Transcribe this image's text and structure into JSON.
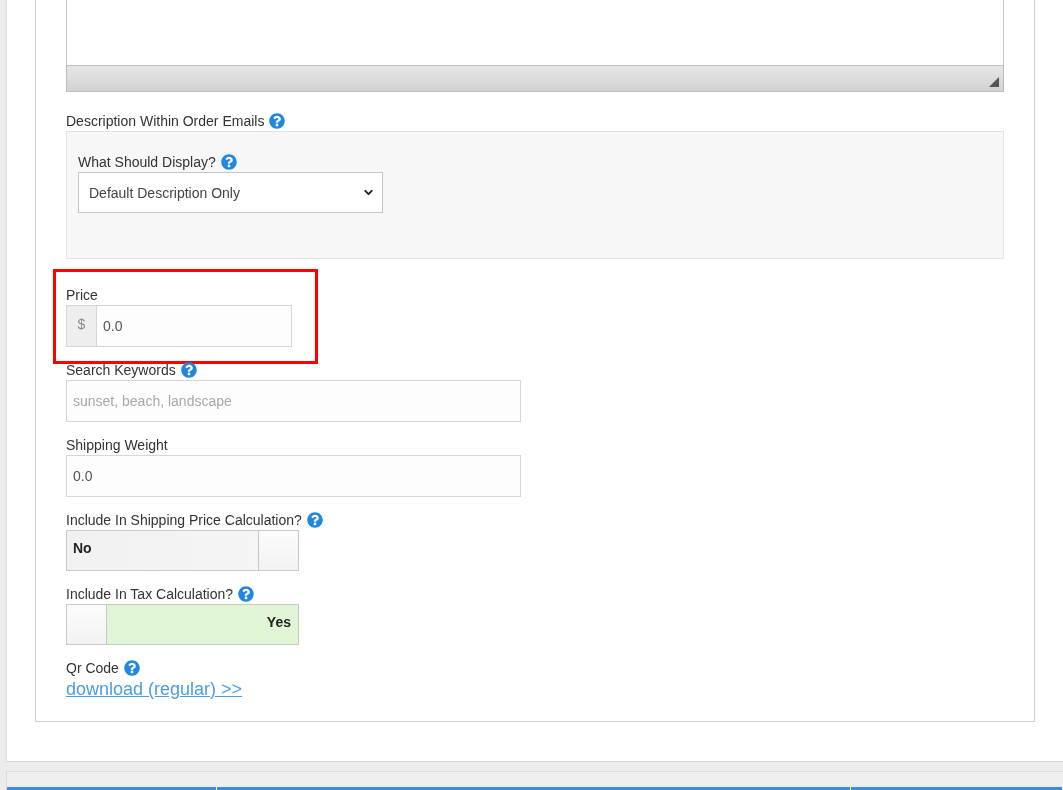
{
  "email_description": {
    "label": "Description Within Order Emails",
    "help": true,
    "display": {
      "label": "What Should Display?",
      "help": true,
      "value": "Default Description Only"
    }
  },
  "fields": [
    {
      "kind": "currency",
      "label": "Price",
      "help": false,
      "highlighted": true,
      "prefix": "$",
      "value": "0.0"
    },
    {
      "kind": "text",
      "label": "Search Keywords",
      "help": true,
      "highlighted": false,
      "placeholder": "sunset, beach, landscape"
    },
    {
      "kind": "text",
      "label": "Shipping Weight",
      "help": false,
      "highlighted": false,
      "value": "0.0"
    },
    {
      "kind": "toggle",
      "label": "Include In Shipping Price Calculation?",
      "help": true,
      "highlighted": false,
      "on": false,
      "text": "No"
    },
    {
      "kind": "toggle",
      "label": "Include In Tax Calculation?",
      "help": true,
      "highlighted": false,
      "on": true,
      "text": "Yes"
    },
    {
      "kind": "link",
      "label": "Qr Code",
      "help": true,
      "highlighted": false,
      "link": "download (regular) >>"
    }
  ]
}
